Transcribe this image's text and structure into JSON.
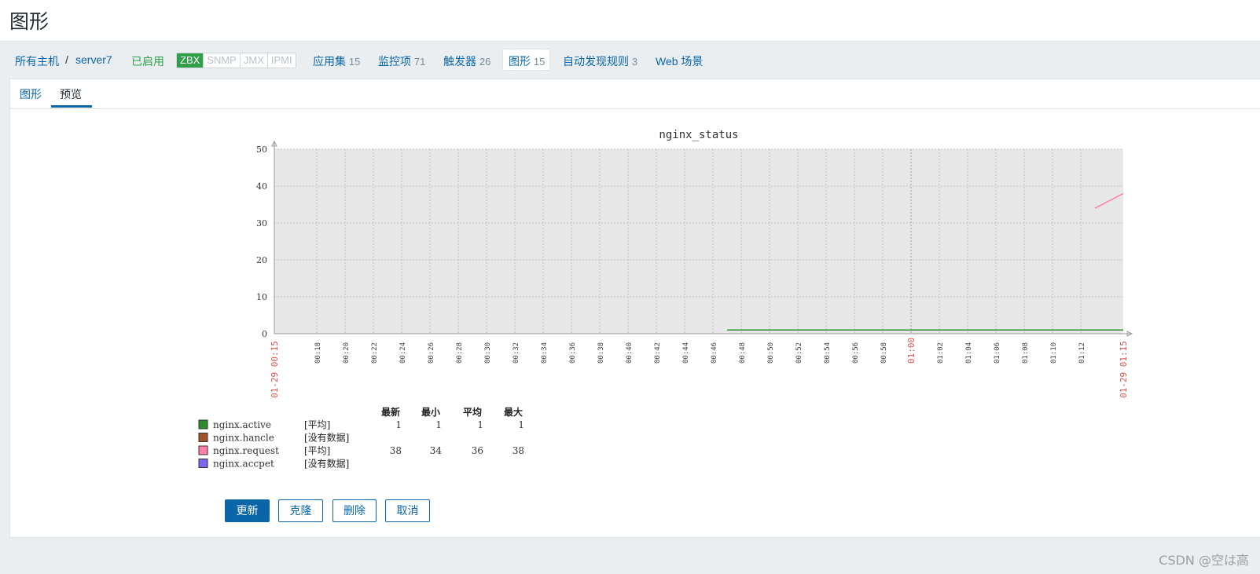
{
  "header": {
    "title": "图形"
  },
  "nav": {
    "all_hosts": "所有主机",
    "separator": "/",
    "host": "server7",
    "enabled": "已启用",
    "badges": [
      "ZBX",
      "SNMP",
      "JMX",
      "IPMI"
    ],
    "links": [
      {
        "label": "应用集",
        "count": "15"
      },
      {
        "label": "监控项",
        "count": "71"
      },
      {
        "label": "触发器",
        "count": "26"
      },
      {
        "label": "图形",
        "count": "15"
      },
      {
        "label": "自动发现规则",
        "count": "3"
      },
      {
        "label": "Web 场景",
        "count": ""
      }
    ]
  },
  "subtabs": {
    "graph": "图形",
    "preview": "预览"
  },
  "chart_data": {
    "type": "line",
    "title": "nginx_status",
    "ylim": [
      0,
      50
    ],
    "yticks": [
      "0",
      "10",
      "20",
      "30",
      "40",
      "50"
    ],
    "x_start_label": "01-29 00:15",
    "x_end_label": "01-29 01:15",
    "x_ticks": [
      "00:18",
      "00:20",
      "00:22",
      "00:24",
      "00:26",
      "00:28",
      "00:30",
      "00:32",
      "00:34",
      "00:36",
      "00:38",
      "00:40",
      "00:42",
      "00:44",
      "00:46",
      "00:48",
      "00:50",
      "00:52",
      "00:54",
      "00:56",
      "00:58",
      "01:00",
      "01:02",
      "01:04",
      "01:06",
      "01:08",
      "01:10",
      "01:12"
    ],
    "highlight_tick": "01:00",
    "grid": true,
    "series": [
      {
        "name": "nginx.active",
        "color": "#2e8b2e",
        "x": [
          "00:47",
          "01:15"
        ],
        "y": [
          1,
          1
        ]
      },
      {
        "name": "nginx.request",
        "color": "#ff7fa6",
        "x": [
          "01:13",
          "01:15"
        ],
        "y": [
          34,
          38
        ]
      }
    ],
    "legend": {
      "headers": [
        "最新",
        "最小",
        "平均",
        "最大"
      ],
      "rows": [
        {
          "name": "nginx.active",
          "color": "#2e8b2e",
          "func": "[平均]",
          "last": "1",
          "min": "1",
          "avg": "1",
          "max": "1"
        },
        {
          "name": "nginx.hancle",
          "color": "#a0522d",
          "func": "[没有数据]",
          "last": "",
          "min": "",
          "avg": "",
          "max": ""
        },
        {
          "name": "nginx.request",
          "color": "#ff7fa6",
          "func": "[平均]",
          "last": "38",
          "min": "34",
          "avg": "36",
          "max": "38"
        },
        {
          "name": "nginx.accpet",
          "color": "#7b68ee",
          "func": "[没有数据]",
          "last": "",
          "min": "",
          "avg": "",
          "max": ""
        }
      ]
    }
  },
  "buttons": {
    "update": "更新",
    "clone": "克隆",
    "delete": "删除",
    "cancel": "取消"
  },
  "watermark": "CSDN @空は高"
}
